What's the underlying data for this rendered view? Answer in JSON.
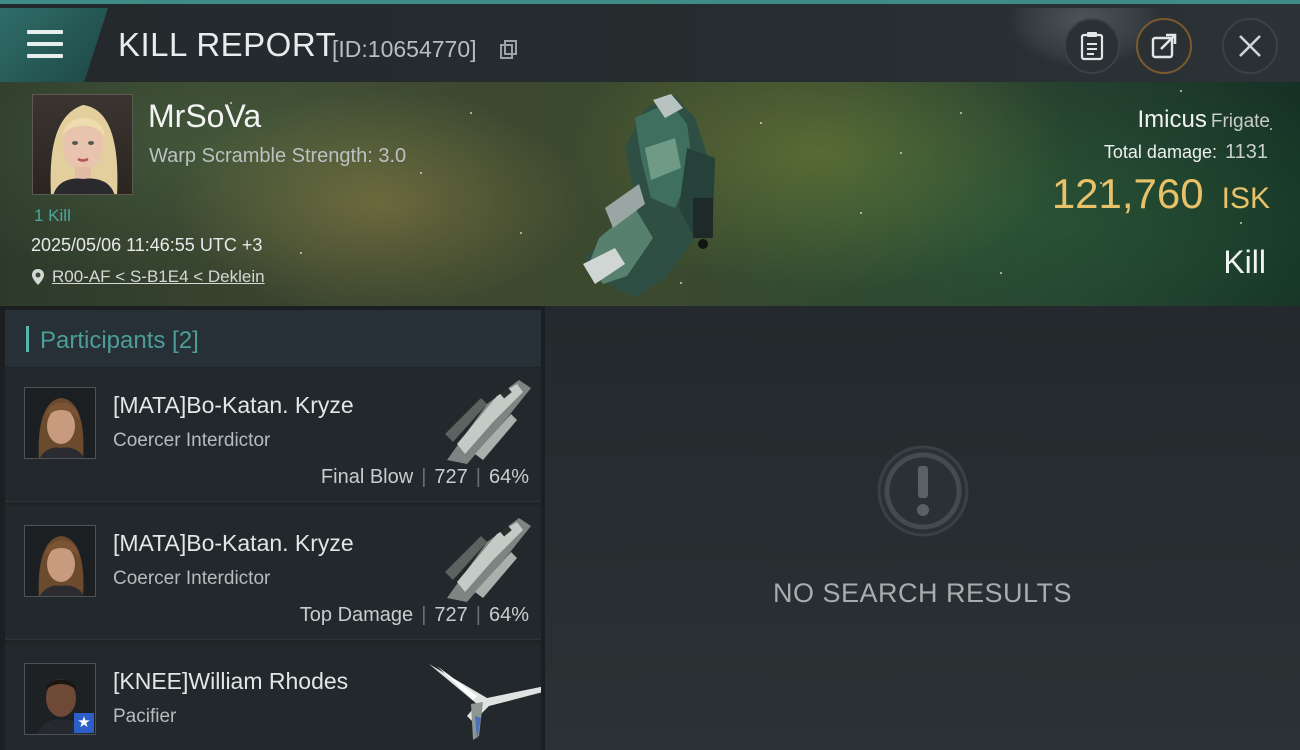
{
  "header": {
    "title": "KILL REPORT",
    "report_id": "[ID:10654770]"
  },
  "victim": {
    "name": "MrSoVa",
    "warp_scramble": "Warp Scramble Strength: 3.0",
    "kills": "1 Kill",
    "datetime": "2025/05/06 11:46:55 UTC +3",
    "location": "R00-AF < S-B1E4 < Deklein",
    "ship_name": "Imicus",
    "ship_class": "Frigate",
    "total_damage_label": "Total damage:",
    "total_damage": "1131",
    "isk_value": "121,760",
    "isk_unit": "ISK",
    "result": "Kill"
  },
  "participants": {
    "header": "Participants [2]",
    "rows": [
      {
        "name": "[MATA]Bo-Katan. Kryze",
        "ship": "Coercer Interdictor",
        "tag": "Final Blow",
        "damage": "727",
        "percent": "64%"
      },
      {
        "name": "[MATA]Bo-Katan. Kryze",
        "ship": "Coercer Interdictor",
        "tag": "Top Damage",
        "damage": "727",
        "percent": "64%"
      },
      {
        "name": "[KNEE]William Rhodes",
        "ship": "Pacifier"
      }
    ]
  },
  "results": {
    "empty_text": "NO SEARCH RESULTS"
  },
  "colors": {
    "accent_teal": "#4d9d98",
    "isk_gold": "#e8c26a",
    "export_ring": "#7a5a2e"
  },
  "icons": [
    "menu-icon",
    "copy-icon",
    "clipboard-icon",
    "export-icon",
    "close-icon",
    "location-pin-icon",
    "exclamation-icon",
    "star-badge-icon"
  ]
}
